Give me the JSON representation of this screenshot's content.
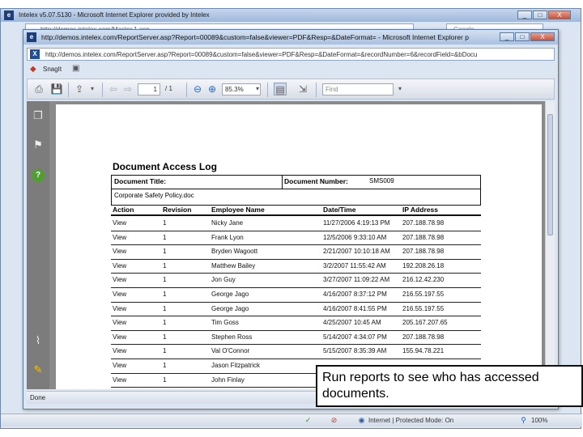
{
  "outer_window": {
    "title": "Intelex v5.07.5130 - Microsoft Internet Explorer provided by Intelex",
    "address": "http://demos.intelex.com/Master.1.asp",
    "search_placeholder": "Google",
    "controls": [
      "_",
      "□",
      "X"
    ]
  },
  "popup_window": {
    "title": "http://demos.intelex.com/ReportServer.asp?Report=00089&custom=false&viewer=PDF&Resp=&DateFormat= - Microsoft Internet Explorer p",
    "address": "http://demos.intelex.com/ReportServer.asp?Report=00089&custom=false&viewer=PDF&Resp=&DateFormat=&recordNumber=6&recordField=&bDocu",
    "controls": [
      "_",
      "□",
      "X"
    ],
    "links_bar_label": "SnagIt"
  },
  "pdf_toolbar": {
    "page_current": "1",
    "page_total": "/ 1",
    "zoom": "85.3%",
    "find_placeholder": "Find"
  },
  "document": {
    "heading": "Document Access Log",
    "document_title_label": "Document Title:",
    "document_title_value": "Corporate Safety Policy.doc",
    "document_number_label": "Document Number:",
    "document_number_value": "SMS009",
    "columns": [
      "Action",
      "Revision",
      "Employee Name",
      "Date/Time",
      "IP Address"
    ],
    "rows": [
      [
        "View",
        "1",
        "Nicky Jane",
        "11/27/2006 4:19:13 PM",
        "207.188.78.98"
      ],
      [
        "View",
        "1",
        "Frank Lyon",
        "12/5/2006 9:33:10 AM",
        "207.188.78.98"
      ],
      [
        "View",
        "1",
        "Bryden Wagoott",
        "2/21/2007 10:10:18 AM",
        "207.188.78.98"
      ],
      [
        "View",
        "1",
        "Matthew Bailey",
        "3/2/2007 11:55:42 AM",
        "192.208.26.18"
      ],
      [
        "View",
        "1",
        "Jon Guy",
        "3/27/2007 11:09:22 AM",
        "216.12.42.230"
      ],
      [
        "View",
        "1",
        "George Jago",
        "4/16/2007 8:37:12 PM",
        "216.55.197.55"
      ],
      [
        "View",
        "1",
        "George Jago",
        "4/16/2007 8:41:55 PM",
        "216.55.197.55"
      ],
      [
        "View",
        "1",
        "Tim Goss",
        "4/25/2007 10:45 AM",
        "205.167.207.65"
      ],
      [
        "View",
        "1",
        "Stephen Ross",
        "5/14/2007 4:34:07 PM",
        "207.188.78.98"
      ],
      [
        "View",
        "1",
        "Val O'Connor",
        "5/15/2007 8:35:39 AM",
        "155.94.78.221"
      ],
      [
        "View",
        "1",
        "Jason Fitzpatrick",
        "",
        ""
      ],
      [
        "View",
        "1",
        "John Finlay",
        "",
        ""
      ]
    ]
  },
  "popup_status": "Done",
  "browser_status": {
    "zone": "Internet | Protected Mode: On",
    "zoom": "100%"
  },
  "callout": {
    "text": "Run reports to see who has accessed documents."
  },
  "colors": {
    "title_bar": "#a9c0df",
    "pdf_sidebar": "#7c7c7c",
    "help_icon": "#4f9f2f"
  }
}
